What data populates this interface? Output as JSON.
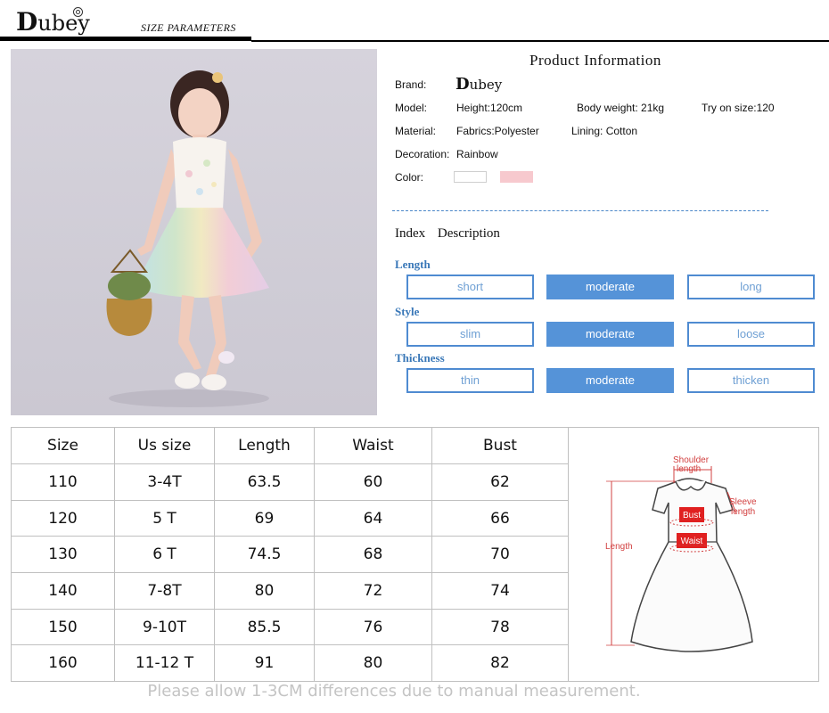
{
  "header": {
    "logo_initial": "D",
    "logo_rest": "ubey",
    "section_title": "SIZE  PARAMETERS"
  },
  "photo": {
    "icon": "girl-in-rainbow-tulle-dress-photo"
  },
  "product_info": {
    "title": "Product  Information",
    "brand_label": "Brand:",
    "brand_initial": "D",
    "brand_rest": "ubey",
    "model_label": "Model:",
    "height": "Height:120cm",
    "body_weight": "Body weight: 21kg",
    "try_on_size": "Try on size:120",
    "material_label": "Material:",
    "fabrics": "Fabrics:Polyester",
    "lining": "Lining: Cotton",
    "decoration_label": "Decoration:",
    "decoration": "Rainbow",
    "color_label": "Color:",
    "colors": [
      "#ffffff",
      "#f7c9ce"
    ]
  },
  "index": {
    "title": "Index Description",
    "categories": [
      {
        "label": "Length",
        "options": [
          "short",
          "moderate",
          "long"
        ],
        "selected": 1
      },
      {
        "label": "Style",
        "options": [
          "slim",
          "moderate",
          "loose"
        ],
        "selected": 1
      },
      {
        "label": "Thickness",
        "options": [
          "thin",
          "moderate",
          "thicken"
        ],
        "selected": 1
      }
    ],
    "accent_color": "#5593d8"
  },
  "size_table": {
    "headers": [
      "Size",
      "Us size",
      "Length",
      "Waist",
      "Bust"
    ],
    "rows": [
      [
        "110",
        "3-4T",
        "63.5",
        "60",
        "62"
      ],
      [
        "120",
        "5 T",
        "69",
        "64",
        "66"
      ],
      [
        "130",
        "6 T",
        "74.5",
        "68",
        "70"
      ],
      [
        "140",
        "7-8T",
        "80",
        "72",
        "74"
      ],
      [
        "150",
        "9-10T",
        "85.5",
        "76",
        "78"
      ],
      [
        "160",
        "11-12 T",
        "91",
        "80",
        "82"
      ]
    ]
  },
  "diagram": {
    "shoulder": "Shoulder",
    "shoulder2": "length",
    "sleeve": "Sleeve",
    "sleeve2": "length",
    "bust": "Bust",
    "waist": "Waist",
    "length": "Length"
  },
  "footnote": "Please allow 1-3CM differences due to manual measurement."
}
